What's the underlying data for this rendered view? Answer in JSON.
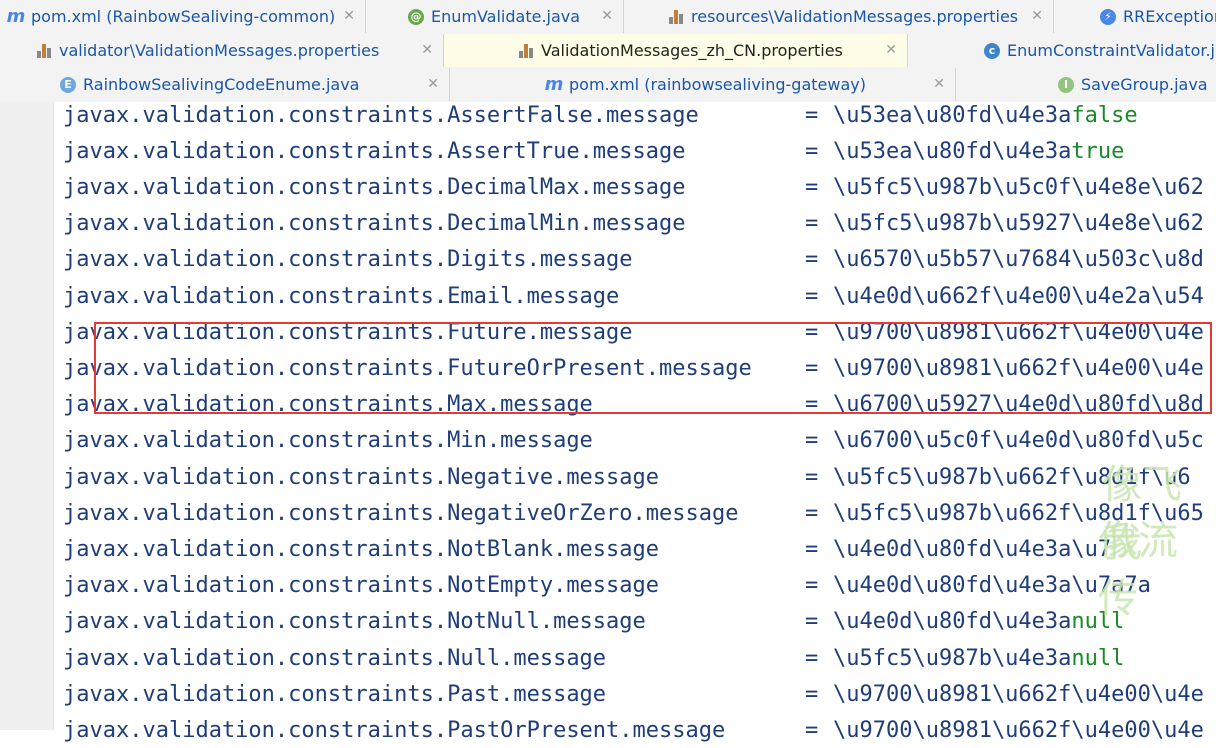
{
  "tabs_row1": [
    {
      "label": "pom.xml (RainbowSealiving-common)",
      "icon": "maven-m-icon"
    },
    {
      "label": "EnumValidate.java",
      "icon": "annotation-icon"
    },
    {
      "label": "resources\\ValidationMessages.properties",
      "icon": "properties-icon"
    },
    {
      "label": "RRException",
      "icon": "exception-class-icon"
    }
  ],
  "tabs_row2": [
    {
      "label": "validator\\ValidationMessages.properties",
      "icon": "properties-icon"
    },
    {
      "label": "ValidationMessages_zh_CN.properties",
      "icon": "properties-icon",
      "active": true
    },
    {
      "label": "EnumConstraintValidator.java",
      "icon": "class-icon"
    }
  ],
  "tabs_row3": [
    {
      "label": "RainbowSealivingCodeEnume.java",
      "icon": "enum-icon"
    },
    {
      "label": "pom.xml (rainbowsealiving-gateway)",
      "icon": "maven-m-icon"
    },
    {
      "label": "SaveGroup.java",
      "icon": "interface-icon"
    }
  ],
  "lines": [
    {
      "key": "javax.validation.constraints.AssertFalse.message",
      "eq": "=",
      "value": "\\u53ea\\u80fd\\u4e3a",
      "tail": "false"
    },
    {
      "key": "javax.validation.constraints.AssertTrue.message",
      "eq": "=",
      "value": "\\u53ea\\u80fd\\u4e3a",
      "tail": "true"
    },
    {
      "key": "javax.validation.constraints.DecimalMax.message",
      "eq": "=",
      "value": "\\u5fc5\\u987b\\u5c0f\\u4e8e\\u62",
      "tail": ""
    },
    {
      "key": "javax.validation.constraints.DecimalMin.message",
      "eq": "=",
      "value": "\\u5fc5\\u987b\\u5927\\u4e8e\\u62",
      "tail": ""
    },
    {
      "key": "javax.validation.constraints.Digits.message",
      "eq": "=",
      "value": "\\u6570\\u5b57\\u7684\\u503c\\u8d",
      "tail": ""
    },
    {
      "key": "javax.validation.constraints.Email.message",
      "eq": "=",
      "value": "\\u4e0d\\u662f\\u4e00\\u4e2a\\u54",
      "tail": ""
    },
    {
      "key": "javax.validation.constraints.Future.message",
      "eq": "=",
      "value": "\\u9700\\u8981\\u662f\\u4e00\\u4e",
      "tail": ""
    },
    {
      "key": "javax.validation.constraints.FutureOrPresent.message",
      "eq": "=",
      "value": "\\u9700\\u8981\\u662f\\u4e00\\u4e",
      "tail": ""
    },
    {
      "key": "javax.validation.constraints.Max.message",
      "eq": "=",
      "value": "\\u6700\\u5927\\u4e0d\\u80fd\\u8d",
      "tail": ""
    },
    {
      "key": "javax.validation.constraints.Min.message",
      "eq": "=",
      "value": "\\u6700\\u5c0f\\u4e0d\\u80fd\\u5c",
      "tail": ""
    },
    {
      "key": "javax.validation.constraints.Negative.message",
      "eq": "=",
      "value": "\\u5fc5\\u987b\\u662f\\u8d1f\\u6",
      "tail": ""
    },
    {
      "key": "javax.validation.constraints.NegativeOrZero.message",
      "eq": "=",
      "value": "\\u5fc5\\u987b\\u662f\\u8d1f\\u65",
      "tail": ""
    },
    {
      "key": "javax.validation.constraints.NotBlank.message",
      "eq": "=",
      "value": "\\u4e0d\\u80fd\\u4e3a\\u7",
      "tail": ""
    },
    {
      "key": "javax.validation.constraints.NotEmpty.message",
      "eq": "=",
      "value": "\\u4e0d\\u80fd\\u4e3a\\u7a7a",
      "tail": ""
    },
    {
      "key": "javax.validation.constraints.NotNull.message",
      "eq": "=",
      "value": "\\u4e0d\\u80fd\\u4e3a",
      "tail": "null"
    },
    {
      "key": "javax.validation.constraints.Null.message",
      "eq": "=",
      "value": "\\u5fc5\\u987b\\u4e3a",
      "tail": "null"
    },
    {
      "key": "javax.validation.constraints.Past.message",
      "eq": "=",
      "value": "\\u9700\\u8981\\u662f\\u4e00\\u4e",
      "tail": ""
    },
    {
      "key": "javax.validation.constraints.PastOrPresent.message",
      "eq": "=",
      "value": "\\u9700\\u8981\\u662f\\u4e00\\u4e",
      "tail": ""
    }
  ],
  "watermark": {
    "line1": "像飞我",
    "line2": "像流传"
  },
  "colors": {
    "keyword": "#1f3d7a",
    "literal": "#198a2a",
    "highlight_box": "#e53935",
    "tab_label": "#1a56a8"
  }
}
